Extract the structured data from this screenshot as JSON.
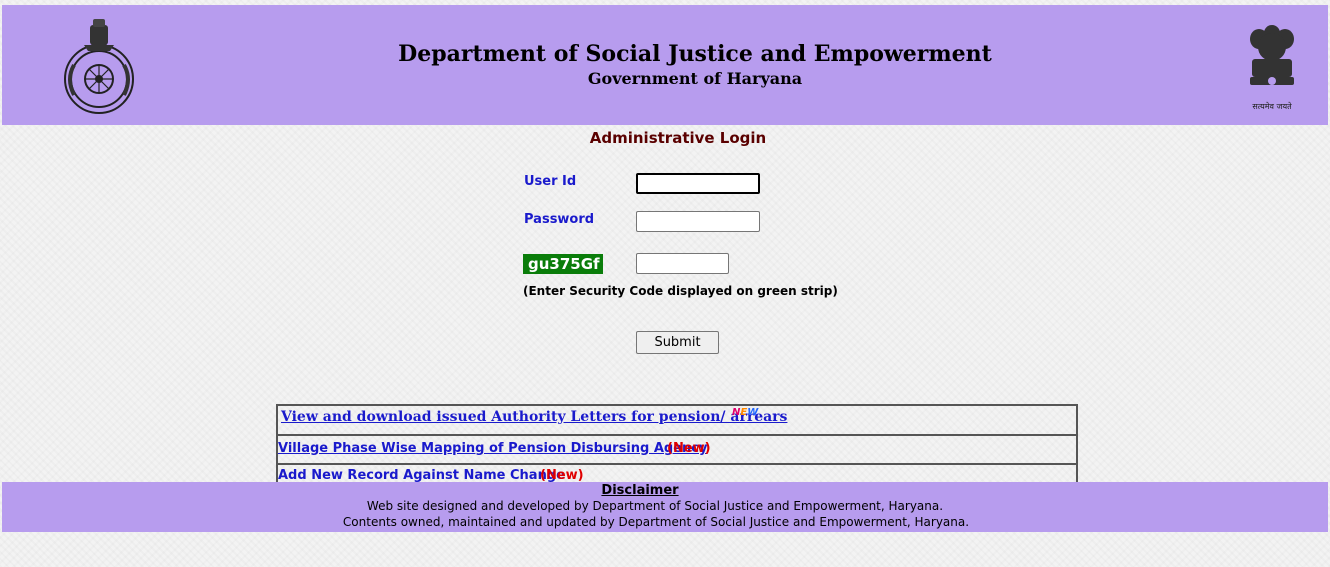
{
  "header": {
    "title": "Department of Social Justice and Empowerment",
    "subtitle": "Government of Haryana",
    "left_logo": "haryana-state-emblem",
    "right_logo": "national-emblem-ashoka-lion",
    "right_logo_motto": "सत्यमेव जयते",
    "background_color": "#b79cee"
  },
  "login": {
    "heading": "Administrative Login",
    "user_id_label": "User Id",
    "user_id_value": "",
    "password_label": "Password",
    "password_value": "",
    "captcha_code": "gu375Gf",
    "captcha_color": "#0a7d0a",
    "security_code_value": "",
    "hint": "(Enter Security Code displayed on green strip)",
    "submit_label": "Submit"
  },
  "links": [
    {
      "text": "View and download issued Authority Letters for pension/ arrears ",
      "badge": "NEW"
    },
    {
      "text": "Village Phase Wise Mapping of Pension Disbursing Agency",
      "badge": " (New)"
    },
    {
      "text": "Add New Record Against Name Change",
      "badge": "(New)"
    }
  ],
  "footer": {
    "disclaimer": "Disclaimer",
    "line1": "Web site designed and developed by Department of Social Justice and Empowerment, Haryana.",
    "line2": "Contents owned, maintained and updated by Department of Social Justice and Empowerment, Haryana."
  }
}
